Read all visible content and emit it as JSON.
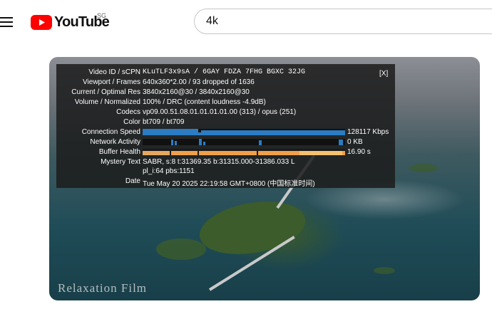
{
  "header": {
    "logo_text": "YouTube",
    "region": "SG",
    "search_value": "4k"
  },
  "player": {
    "watermark": "Relaxation Film"
  },
  "stats": {
    "close_label": "[X]",
    "rows": {
      "video_id": {
        "label": "Video ID / sCPN",
        "value": "KLuTLF3x9sA / 6GAY FDZA 7FHG BGXC 32JG"
      },
      "viewport": {
        "label": "Viewport / Frames",
        "value": "640x360*2.00 / 93 dropped of 1636"
      },
      "resolution": {
        "label": "Current / Optimal Res",
        "value": "3840x2160@30 / 3840x2160@30"
      },
      "volume": {
        "label": "Volume / Normalized",
        "value": "100% / DRC (content loudness -4.9dB)"
      },
      "codecs": {
        "label": "Codecs",
        "value": "vp09.00.51.08.01.01.01.01.00 (313) / opus (251)"
      },
      "color": {
        "label": "Color",
        "value": "bt709 / bt709"
      },
      "connection": {
        "label": "Connection Speed",
        "value": "128117 Kbps",
        "color": "#2b7cc2"
      },
      "network": {
        "label": "Network Activity",
        "value": "0 KB",
        "color": "#2b7cc2"
      },
      "buffer": {
        "label": "Buffer Health",
        "value": "16.90 s",
        "color": "#f0a04b"
      },
      "mystery": {
        "label": "Mystery Text",
        "value_line1": "SABR, s:8 t:31369.35 b:31315.000-31386.033 L",
        "value_line2": "pl_i:64 pbs:1151"
      },
      "date": {
        "label": "Date",
        "value": "Tue May 20 2025 22:19:58 GMT+0800 (中国标准时间)"
      }
    }
  }
}
